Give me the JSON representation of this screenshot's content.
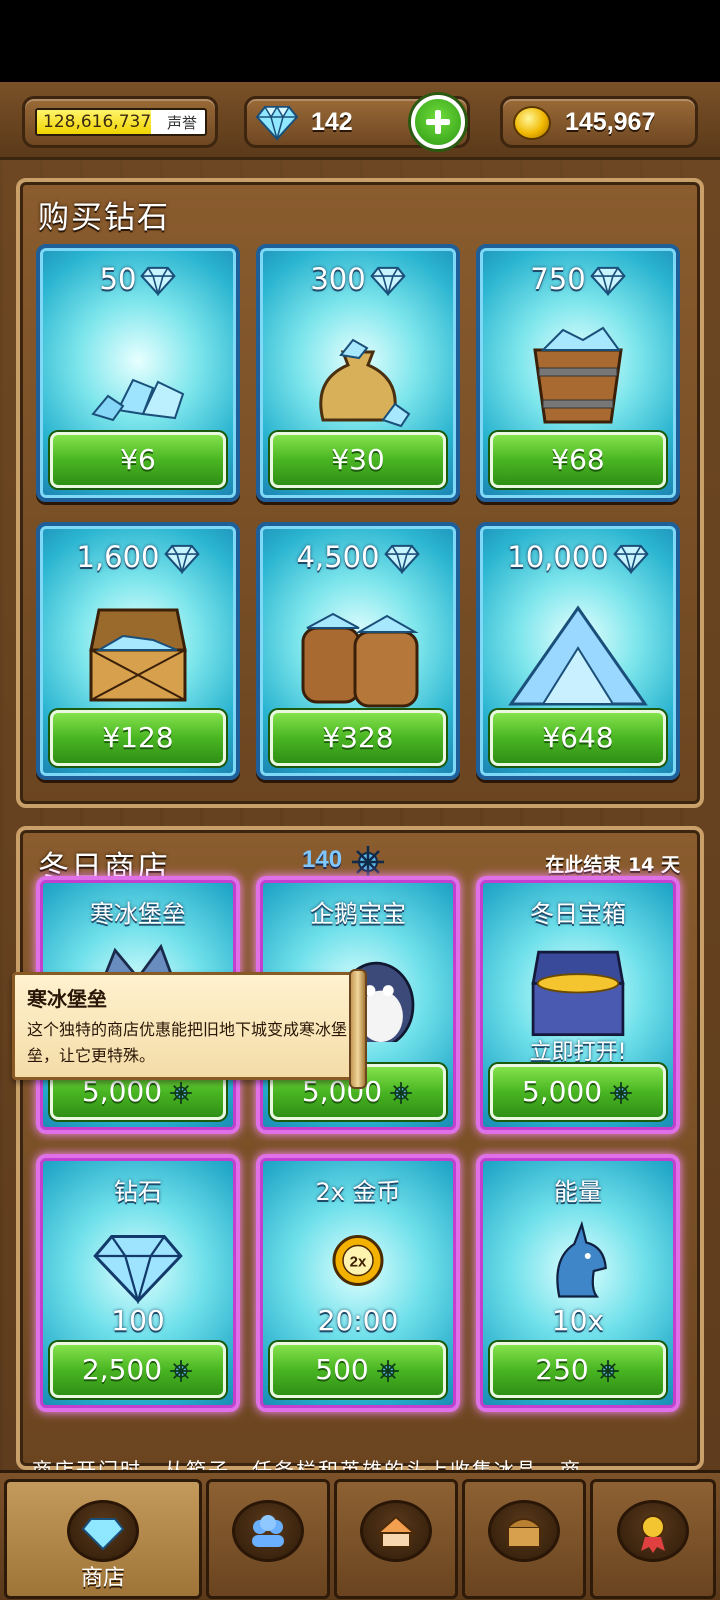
{
  "topbar": {
    "fame_value": "128,616,737",
    "fame_label": "声誉",
    "fame_progress": 0.68,
    "gems": "142",
    "coins": "145,967"
  },
  "buy_diamonds": {
    "title": "购买钻石",
    "packs": [
      {
        "amount": "50",
        "price": "¥6",
        "art": "gem-pile-small"
      },
      {
        "amount": "300",
        "price": "¥30",
        "art": "gem-sack"
      },
      {
        "amount": "750",
        "price": "¥68",
        "art": "gem-bucket"
      },
      {
        "amount": "1,600",
        "price": "¥128",
        "art": "gem-chest"
      },
      {
        "amount": "4,500",
        "price": "¥328",
        "art": "gem-barrels"
      },
      {
        "amount": "10,000",
        "price": "¥648",
        "art": "gem-mountain"
      }
    ]
  },
  "winter_shop": {
    "title": "冬日商店",
    "ice_count": "140",
    "countdown": "在此结束 14 天",
    "items": [
      {
        "title": "寒冰堡垒",
        "sub": "",
        "price": "5,000",
        "art": "ice-fortress"
      },
      {
        "title": "企鹅宝宝",
        "sub": "",
        "price": "5,000",
        "art": "penguin"
      },
      {
        "title": "冬日宝箱",
        "sub": "立即打开!",
        "price": "5,000",
        "art": "winter-chest"
      },
      {
        "title": "钻石",
        "sub": "100",
        "price": "2,500",
        "art": "diamond"
      },
      {
        "title": "2x 金币",
        "sub": "20:00",
        "price": "500",
        "art": "double-coin"
      },
      {
        "title": "能量",
        "sub": "10x",
        "price": "250",
        "art": "unicorn"
      }
    ],
    "tooltip": {
      "title": "寒冰堡垒",
      "body": "这个独特的商店优惠能把旧地下城变成寒冰堡垒，让它更特殊。"
    },
    "footer": "商店开门时，从箱子、任务栏和英雄的头上收集冰晶。商"
  },
  "nav": {
    "tabs": [
      {
        "label": "商店",
        "icon": "diamond-icon",
        "active": true
      },
      {
        "label": "",
        "icon": "heroes-icon",
        "active": false
      },
      {
        "label": "",
        "icon": "village-icon",
        "active": false
      },
      {
        "label": "",
        "icon": "chest-icon",
        "active": false
      },
      {
        "label": "",
        "icon": "medal-icon",
        "active": false
      }
    ]
  },
  "colors": {
    "wood": "#6e4823",
    "button_green": "#49b522",
    "card_cyan": "#2ab4d0",
    "winter_border": "#e070e8"
  }
}
